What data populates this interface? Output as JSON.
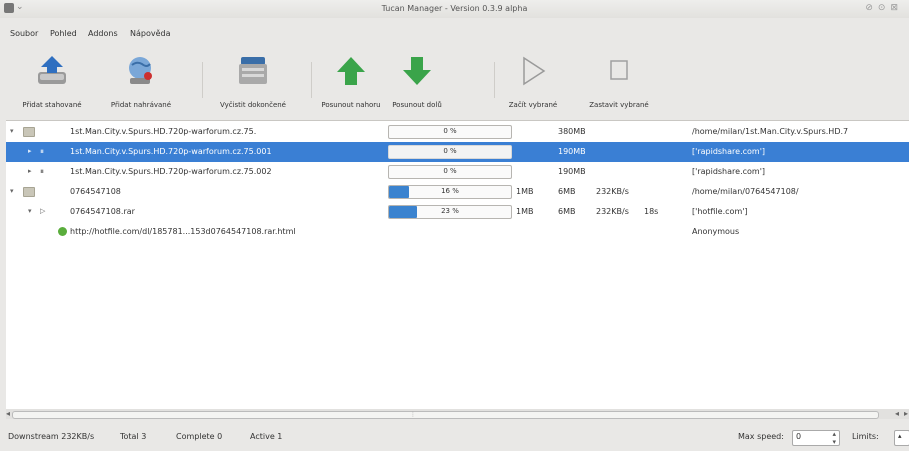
{
  "window": {
    "title": "Tucan Manager - Version 0.3.9 alpha"
  },
  "menu": [
    "Soubor",
    "Pohled",
    "Addons",
    "Nápověda"
  ],
  "toolbar": [
    {
      "label": "Přidat stahované"
    },
    {
      "label": "Přidat nahrávané"
    },
    {
      "label": "Vyčistit dokončené"
    },
    {
      "label": "Posunout nahoru"
    },
    {
      "label": "Posunout dolů"
    },
    {
      "label": "Začít vybrané"
    },
    {
      "label": "Zastavit vybrané"
    }
  ],
  "rows": [
    {
      "name": "1st.Man.City.v.Spurs.HD.720p-warforum.cz.75.",
      "progress_pct": 0,
      "progress_text": "0 %",
      "size": "380MB",
      "path": "/home/milan/1st.Man.City.v.Spurs.HD.7"
    },
    {
      "name": "1st.Man.City.v.Spurs.HD.720p-warforum.cz.75.001",
      "progress_pct": 0,
      "progress_text": "0 %",
      "size": "190MB",
      "path": "['rapidshare.com']"
    },
    {
      "name": "1st.Man.City.v.Spurs.HD.720p-warforum.cz.75.002",
      "progress_pct": 0,
      "progress_text": "0 %",
      "size": "190MB",
      "path": "['rapidshare.com']"
    },
    {
      "name": "0764547108",
      "progress_pct": 16,
      "progress_text": "16 %",
      "done": "1MB",
      "size": "6MB",
      "speed": "232KB/s",
      "path": "/home/milan/0764547108/"
    },
    {
      "name": "0764547108.rar",
      "progress_pct": 23,
      "progress_text": "23 %",
      "done": "1MB",
      "size": "6MB",
      "speed": "232KB/s",
      "eta": "18s",
      "path": "['hotfile.com']"
    },
    {
      "name": "http://hotfile.com/dl/185781...153d0764547108.rar.html",
      "path": "Anonymous"
    }
  ],
  "status": {
    "downstream": "Downstream 232KB/s",
    "total": "Total 3",
    "complete": "Complete 0",
    "active": "Active 1",
    "max_speed_label": "Max speed:",
    "max_speed_value": "0",
    "limits_label": "Limits:"
  },
  "colors": {
    "selection": "#3a7fd4",
    "progress": "#3b83cf",
    "link_dot": "#5aad3c",
    "up_arrow": "#3aa44a"
  }
}
